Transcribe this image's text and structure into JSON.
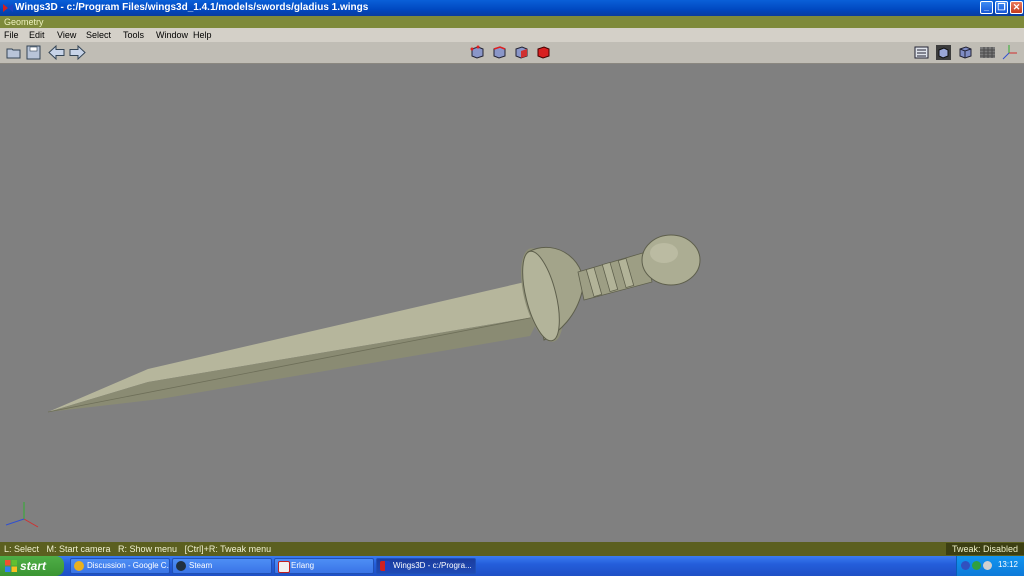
{
  "window": {
    "title": "Wings3D - c:/Program Files/wings3d_1.4.1/models/swords/gladius 1.wings",
    "controls": [
      "minimize-icon",
      "restore-icon",
      "close-icon"
    ]
  },
  "geometry_label": "Geometry",
  "menu": [
    "File",
    "Edit",
    "View",
    "Select",
    "Tools",
    "Window",
    "Help"
  ],
  "toolbar": {
    "left_icons": [
      "open-folder-icon",
      "save-disk-icon",
      "undo-arrow-icon",
      "redo-arrow-icon"
    ],
    "select_mode_icons": [
      "vertex-mode-icon",
      "edge-mode-icon",
      "face-mode-icon",
      "body-mode-icon"
    ],
    "view_icons": [
      "workmode-icon",
      "smooth-shade-icon",
      "cube-view-icon",
      "grid-icon",
      "axes-icon"
    ]
  },
  "viewport": {
    "background": "#808080",
    "model_color": "#a8a88e",
    "axis_colors": {
      "x": "#d03030",
      "y": "#30b030",
      "z": "#3050d0"
    }
  },
  "status": {
    "hints": "L: Select   M: Start camera   R: Show menu   [Ctrl]+R: Tweak menu",
    "tweak": "Tweak: Disabled"
  },
  "taskbar": {
    "start": "start",
    "tasks": [
      {
        "label": "Discussion - Google C...",
        "icon": "chrome-icon",
        "active": false
      },
      {
        "label": "Steam",
        "icon": "steam-icon",
        "active": false
      },
      {
        "label": "Erlang",
        "icon": "erlang-icon",
        "active": false
      },
      {
        "label": "Wings3D - c:/Progra...",
        "icon": "wings3d-icon",
        "active": true
      }
    ],
    "clock": "13:12"
  }
}
